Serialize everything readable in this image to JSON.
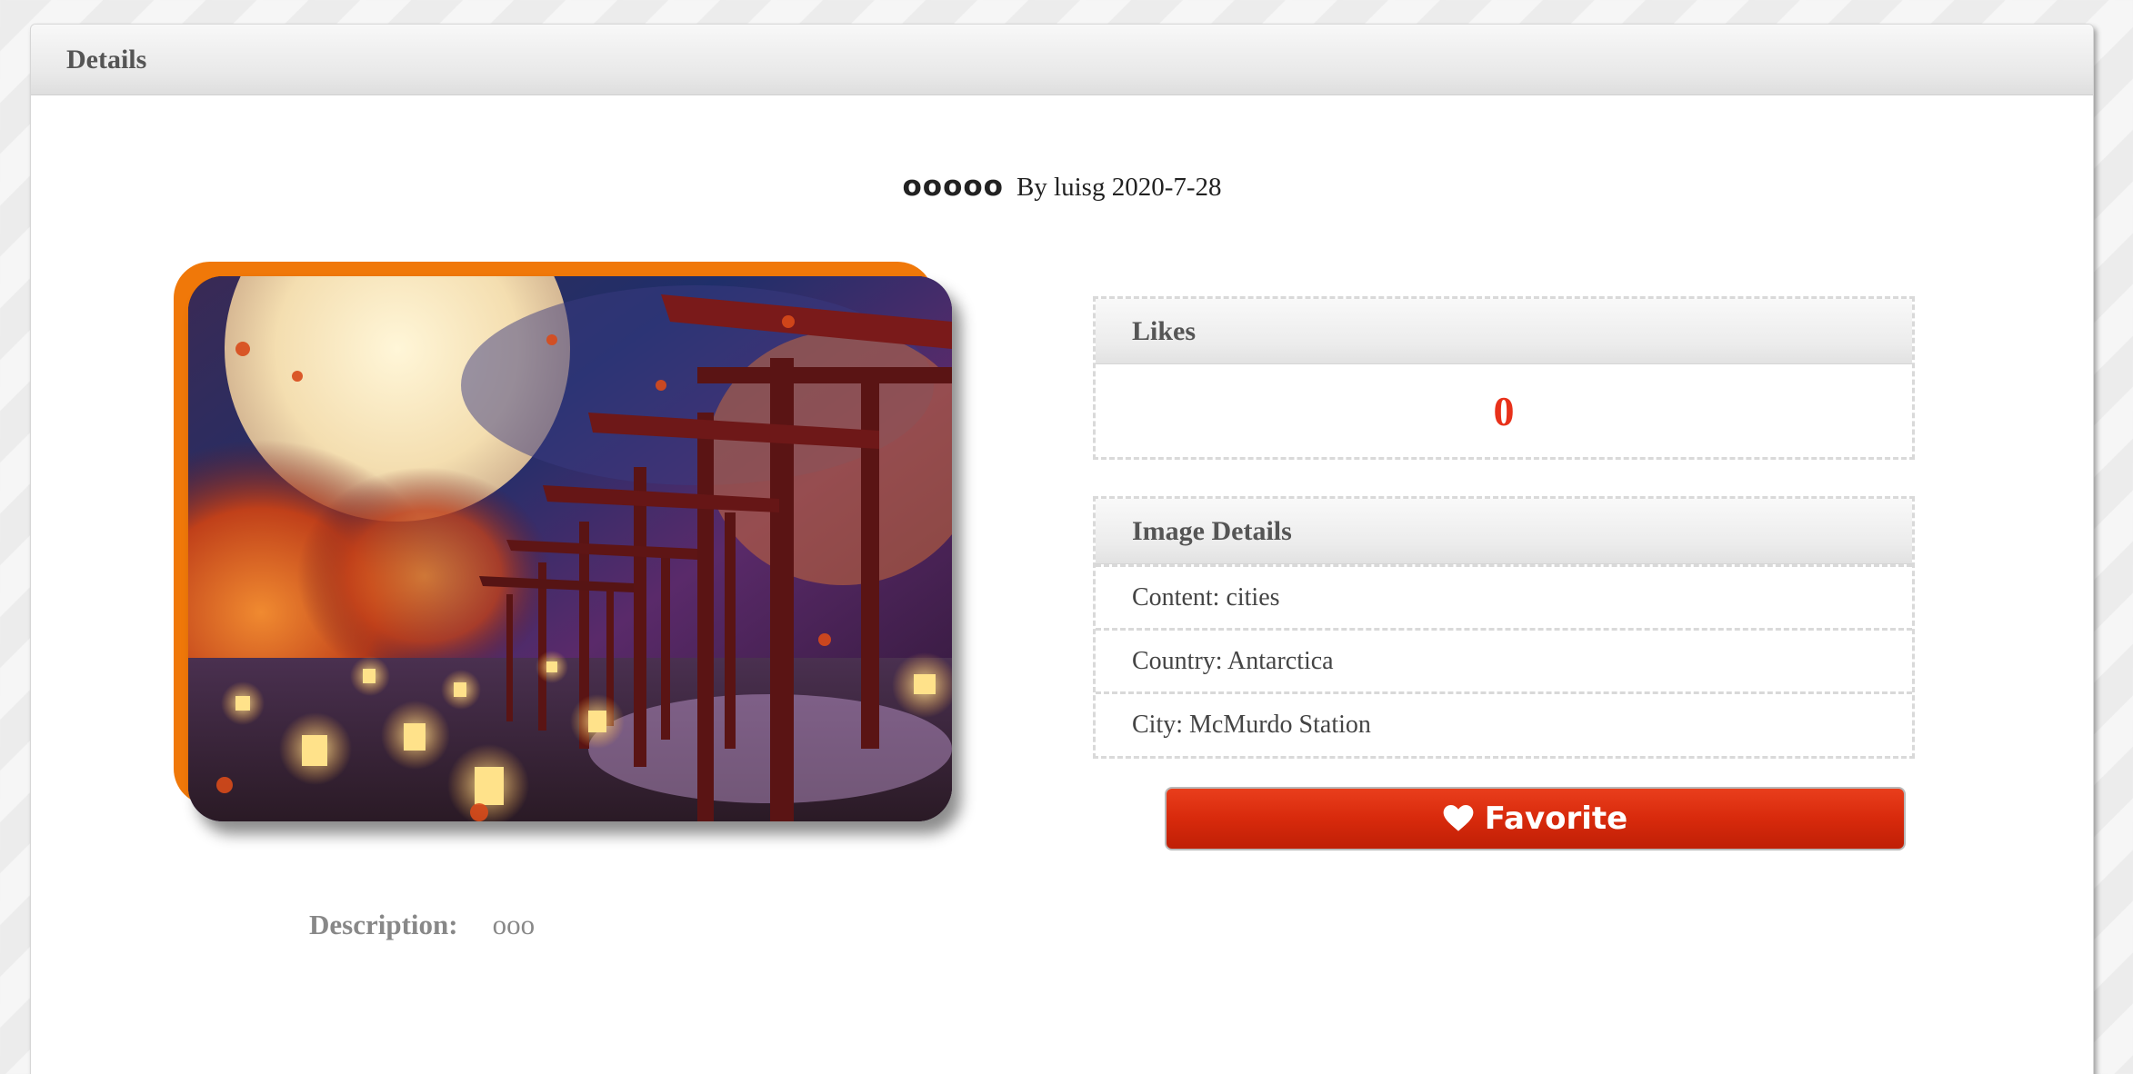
{
  "panel": {
    "title": "Details"
  },
  "post": {
    "title": "ooooo",
    "byline": "By luisg 2020-7-28",
    "description_label": "Description:",
    "description_value": "ooo"
  },
  "likes": {
    "header": "Likes",
    "count": "0"
  },
  "image_details": {
    "header": "Image Details",
    "rows": [
      "Content: cities",
      "Country: Antarctica",
      "City: McMurdo Station"
    ]
  },
  "favorite_button": {
    "label": "Favorite",
    "icon": "heart-icon"
  },
  "colors": {
    "accent_orange": "#f07809",
    "likes_red": "#e8311a",
    "button_red": "#d82a0c"
  }
}
